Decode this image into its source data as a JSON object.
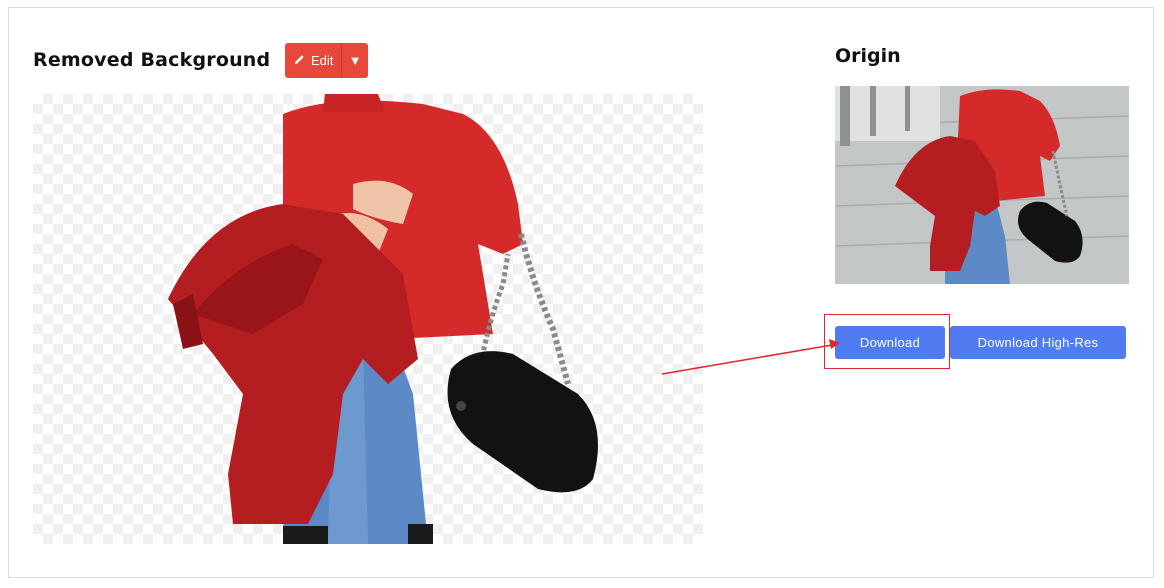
{
  "left_panel": {
    "title": "Removed Background",
    "edit_label": "Edit",
    "caret": "▼"
  },
  "right_panel": {
    "title": "Origin",
    "download_label": "Download",
    "download_hires_label": "Download High-Res"
  },
  "colors": {
    "edit_button": "#e8473c",
    "primary_button": "#4f7cf1",
    "annotation": "#e0262a"
  }
}
